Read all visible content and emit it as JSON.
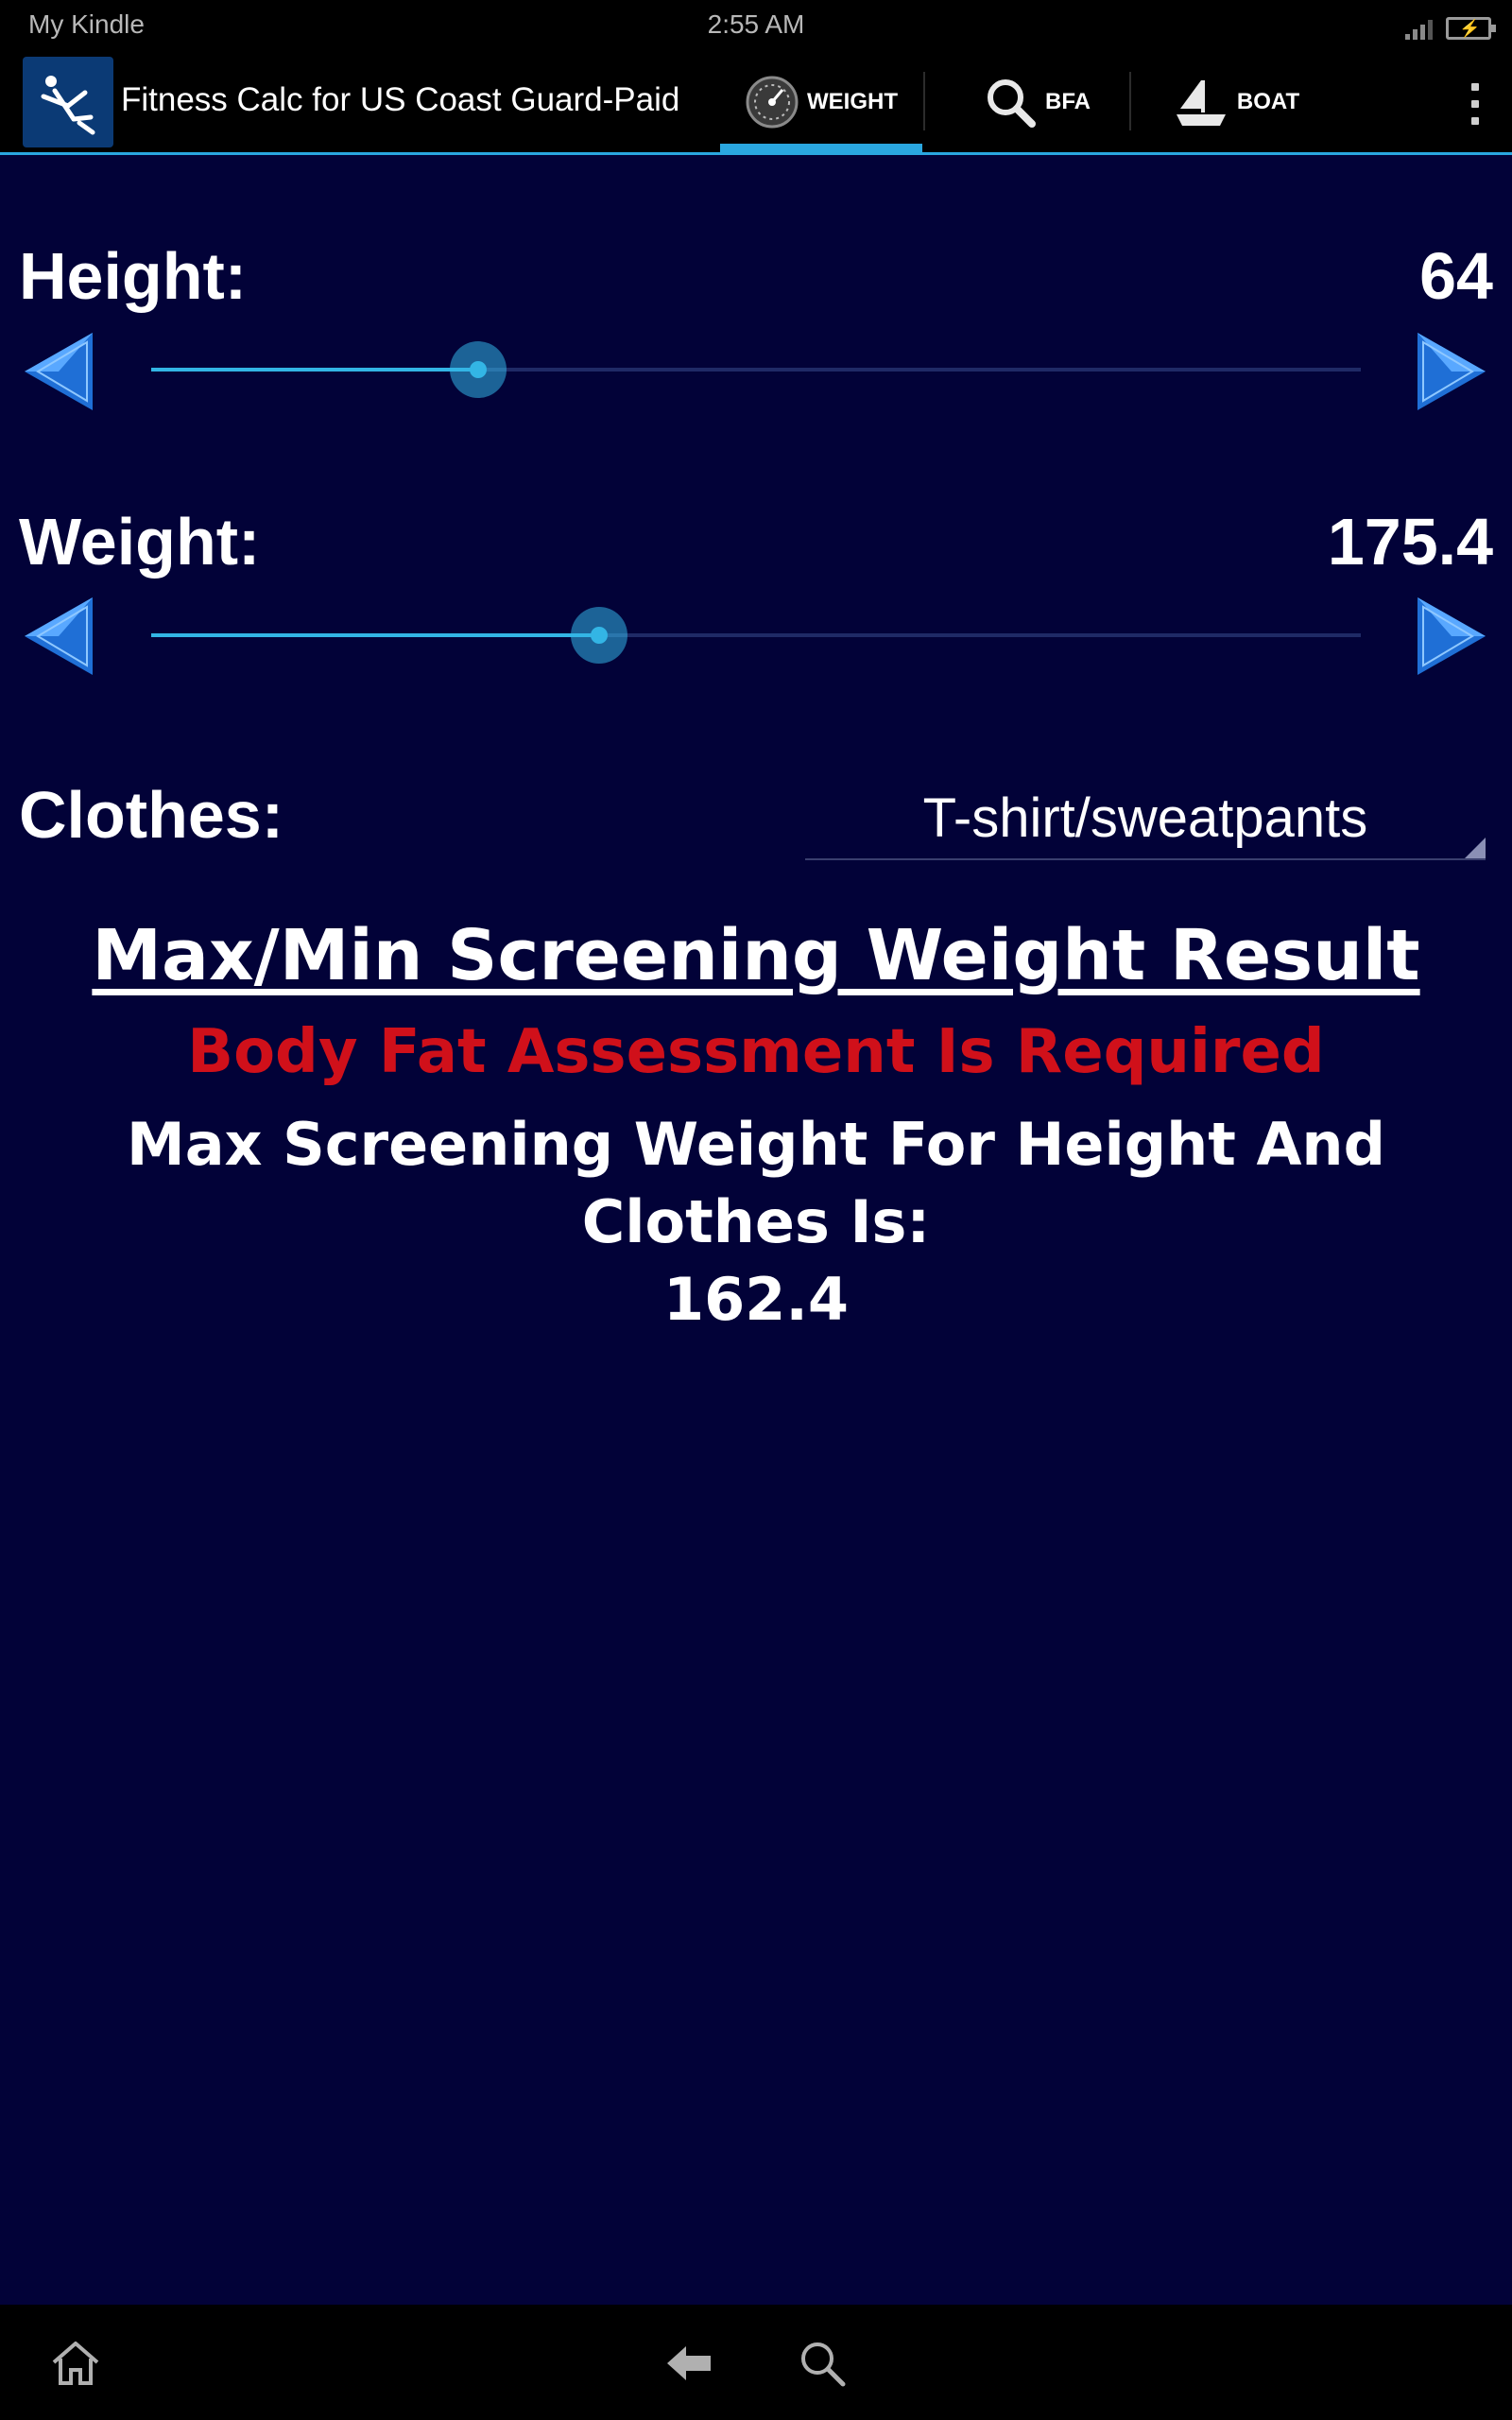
{
  "status_bar": {
    "carrier": "My Kindle",
    "time": "2:55 AM",
    "signal_icon": "signal-strength-icon",
    "battery_icon": "battery-charging-icon"
  },
  "action_bar": {
    "app_icon": "fitness-runner-icon",
    "app_title": "Fitness Calc for US Coast Guard-Paid",
    "tabs": [
      {
        "label": "WEIGHT",
        "icon": "gauge-icon",
        "active": true
      },
      {
        "label": "BFA",
        "icon": "magnifier-icon",
        "active": false
      },
      {
        "label": "BOAT",
        "icon": "sailboat-icon",
        "active": false
      }
    ],
    "overflow_icon": "overflow-menu-icon"
  },
  "height": {
    "label": "Height:",
    "value": "64",
    "slider_fraction": 0.27
  },
  "weight": {
    "label": "Weight:",
    "value": "175.4",
    "slider_fraction": 0.37
  },
  "clothes": {
    "label": "Clothes:",
    "selected": "T-shirt/sweatpants"
  },
  "result": {
    "title": "Max/Min Screening Weight Result",
    "warning": "Body Fat Assessment Is Required",
    "max_label": "Max Screening Weight For Height And Clothes Is:",
    "max_value": "162.4"
  },
  "colors": {
    "background": "#020238",
    "accent": "#33b5e5",
    "warning": "#d0101a"
  },
  "nav_bar": {
    "icons": [
      "home-icon",
      "back-icon",
      "search-icon"
    ]
  }
}
